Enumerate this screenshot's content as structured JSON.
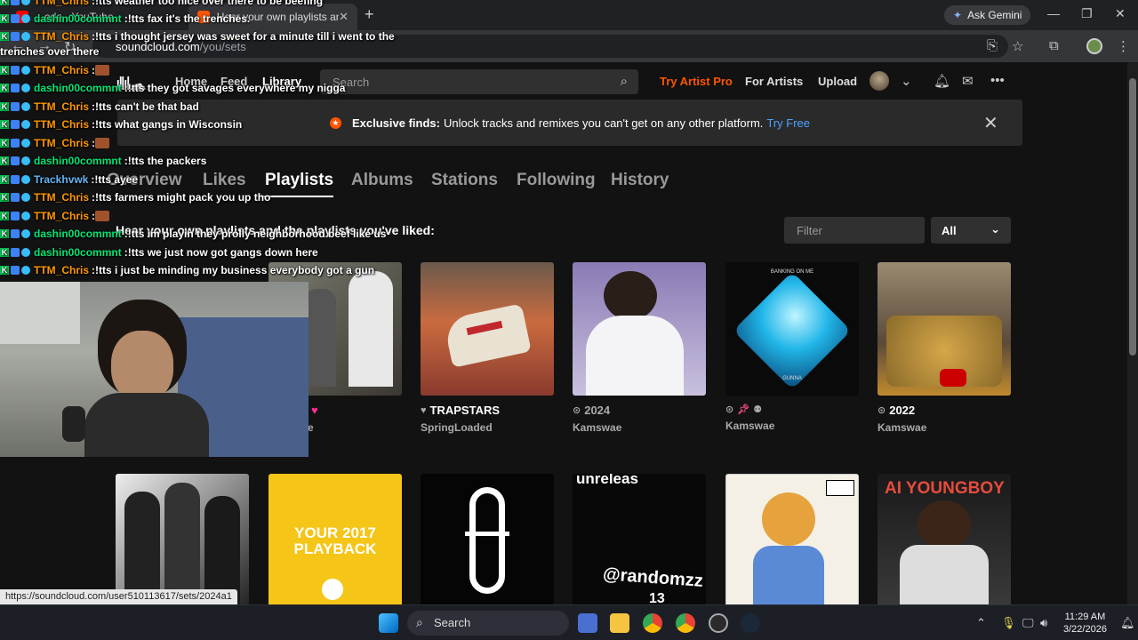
{
  "browser": {
    "tabs": [
      {
        "label": "...ode - YouTube"
      },
      {
        "label": "Hear your own playlists and the"
      }
    ],
    "new_tab": "+",
    "gemini_label": "Ask Gemini",
    "url_host": "soundcloud.com",
    "url_path": "/you/sets"
  },
  "header": {
    "nav": [
      "Home",
      "Feed",
      "Library"
    ],
    "search_placeholder": "Search",
    "try_pro": "Try Artist Pro",
    "for_artists": "For Artists",
    "upload": "Upload"
  },
  "banner": {
    "bold": "Exclusive finds:",
    "text": "Unlock tracks and remixes you can't get on any other platform.",
    "link": "Try Free"
  },
  "tabs": [
    "Overview",
    "Likes",
    "Playlists",
    "Albums",
    "Stations",
    "Following",
    "History"
  ],
  "subtitle": "Hear your own playlists and the playlists you've liked:",
  "filter_placeholder": "Filter",
  "filter_select": "All",
  "cards_row1": [
    {
      "title": "",
      "artist": "e"
    },
    {
      "title": "TRAPSTARS",
      "artist": "SpringLoaded"
    },
    {
      "title": "2024",
      "artist": "Kamswae"
    },
    {
      "title": "",
      "artist": "Kamswae"
    },
    {
      "title": "2022",
      "artist": "Kamswae"
    }
  ],
  "cards_row2_text": {
    "playback_line1": "YOUR 2017",
    "playback_line2": "PLAYBACK",
    "unreleased": "unreleas",
    "randomzz": "@randomzz",
    "randomzz_num": "13",
    "youngboy": "AI YOUNGBOY",
    "banking": "BANKING ON ME",
    "gunna": "GUNNA"
  },
  "chat": [
    {
      "user": "TTM_Chris",
      "color": "#ff9800",
      "msg": "!tts weather too nice over there to be beefing"
    },
    {
      "user": "dashin00commnt",
      "color": "#00e676",
      "msg": "!tts fax it's the trenches."
    },
    {
      "user": "TTM_Chris",
      "color": "#ff9800",
      "msg": "!tts i thought jersey was sweet for a minute till i went to the"
    },
    {
      "user": "",
      "color": "#ffffff",
      "msg": "trenches over there"
    },
    {
      "user": "TTM_Chris",
      "color": "#ff9800",
      "msg": ""
    },
    {
      "user": "dashin00commnt",
      "color": "#00e676",
      "msg": "!tts they got savages everywhere my nigga"
    },
    {
      "user": "TTM_Chris",
      "color": "#ff9800",
      "msg": "!tts can't be that bad"
    },
    {
      "user": "TTM_Chris",
      "color": "#ff9800",
      "msg": "!tts what gangs in Wisconsin"
    },
    {
      "user": "TTM_Chris",
      "color": "#ff9800",
      "msg": ""
    },
    {
      "user": "dashin00commnt",
      "color": "#00e676",
      "msg": "!tts the packers"
    },
    {
      "user": "Trackhvwk",
      "color": "#64b5f6",
      "msg": "!tts ayee"
    },
    {
      "user": "TTM_Chris",
      "color": "#ff9800",
      "msg": "!tts farmers might pack you up tho"
    },
    {
      "user": "TTM_Chris",
      "color": "#ff9800",
      "msg": ""
    },
    {
      "user": "dashin00commnt",
      "color": "#00e676",
      "msg": "!tts im playin they prolly neighborhood beef like us"
    },
    {
      "user": "dashin00commnt",
      "color": "#00e676",
      "msg": "!tts we just now got gangs down here"
    },
    {
      "user": "TTM_Chris",
      "color": "#ff9800",
      "msg": "!tts i just be minding my business everybody got a gun"
    }
  ],
  "status_url": "https://soundcloud.com/user510113617/sets/2024a1",
  "taskbar": {
    "search": "Search",
    "time": "11:29 AM",
    "date": "3/22/2026"
  },
  "colors": {
    "accent": "#ff5500",
    "link": "#4aa3ff",
    "bg": "#121212"
  }
}
